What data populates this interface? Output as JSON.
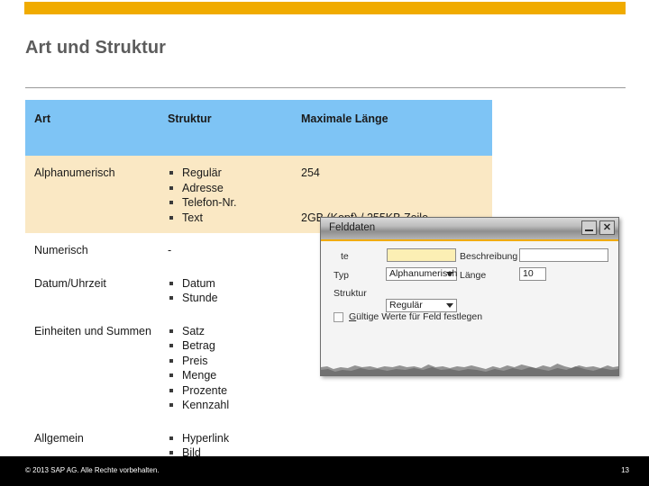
{
  "slide": {
    "title": "Art und Struktur",
    "accent_orange": "#f0ab00",
    "header_blue": "#7ec4f5",
    "row_beige": "#fae8c4"
  },
  "table": {
    "headers": [
      "Art",
      "Struktur",
      "Maximale Länge"
    ],
    "rows": [
      {
        "art": "Alphanumerisch",
        "struktur": [
          "Regulär",
          "Adresse",
          "Telefon-Nr.",
          "Text"
        ],
        "max_lines": [
          "254",
          "",
          "",
          "2GB (Kopf) / 255KB Zeile"
        ],
        "shaded": true
      },
      {
        "art": "Numerisch",
        "struktur_text": "-",
        "max_lines": [
          ""
        ],
        "shaded": false
      },
      {
        "art": "Datum/Uhrzeit",
        "struktur": [
          "Datum",
          "Stunde"
        ],
        "max_lines": [
          ""
        ],
        "shaded": false
      },
      {
        "art": "Einheiten und Summen",
        "struktur": [
          "Satz",
          "Betrag",
          "Preis",
          "Menge",
          "Prozente",
          "Kennzahl"
        ],
        "max_lines": [
          ""
        ],
        "shaded": false
      },
      {
        "art": "Allgemein",
        "struktur": [
          "Hyperlink",
          "Bild"
        ],
        "max_lines": [
          ""
        ],
        "shaded": false
      }
    ]
  },
  "dialog": {
    "title": "Felddaten",
    "minimize_label": "",
    "close_label": "✕",
    "fields": {
      "name_label": "te",
      "name_value": "",
      "beschreibung_label": "Beschreibung",
      "beschreibung_value": "",
      "typ_label": "Typ",
      "typ_value": "Alphanumerisch",
      "laenge_label": "Länge",
      "laenge_value": "10",
      "struktur_label": "Struktur",
      "struktur_value": "Regulär"
    },
    "checkbox": {
      "label_underlined": "G",
      "label_rest": "ültige Werte für Feld festlegen",
      "checked": false
    }
  },
  "footer": {
    "copyright": "© 2013 SAP AG. Alle Rechte vorbehalten.",
    "page_number": "13"
  }
}
